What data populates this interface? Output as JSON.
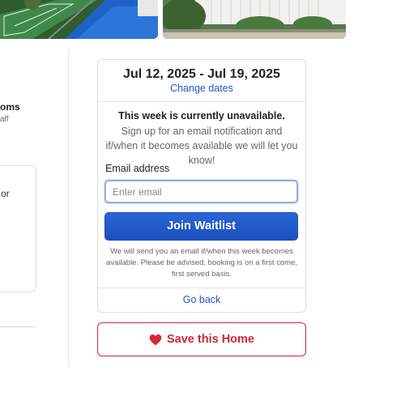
{
  "booking": {
    "dates": "Jul 12, 2025 - Jul 19, 2025",
    "change_dates": "Change dates",
    "unavailable_title": "This week is currently unavailable.",
    "signup_text": "Sign up for an email notification and if/when it becomes available we will let you know!",
    "email_label": "Email address",
    "email_placeholder": "Enter email",
    "email_value": "",
    "waitlist_button": "Join Waitlist",
    "disclaimer": "We will send you an email if/when this week becomes available. Please be advised, booking is on a first come, first served basis.",
    "go_back": "Go back"
  },
  "save_home": {
    "label": "Save this Home",
    "icon": "heart-icon",
    "color": "#c8283a"
  },
  "left_column": {
    "fragment_1": "oms",
    "fragment_2": "alf",
    "card_fragment": "or"
  },
  "colors": {
    "link": "#1f56c8",
    "primary_button": "#1c4fbd",
    "save_accent": "#d3293b"
  }
}
